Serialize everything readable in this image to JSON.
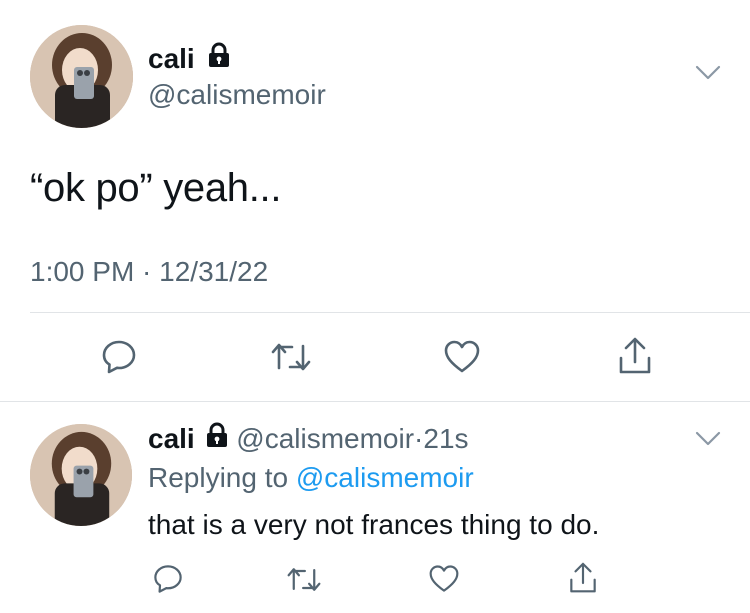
{
  "main_tweet": {
    "display_name": "cali",
    "handle": "@calismemoir",
    "text": "“ok po” yeah...",
    "timestamp": "1:00 PM · 12/31/22",
    "lock_icon": "lock-icon",
    "actions": [
      "reply-icon",
      "retweet-icon",
      "like-icon",
      "share-icon"
    ]
  },
  "reply_tweet": {
    "display_name": "cali",
    "handle": "@calismemoir",
    "separator": "·",
    "time": "21s",
    "replying_prefix": "Replying to",
    "replying_handle": "@calismemoir",
    "text": "that is a very not frances thing to do.",
    "actions": [
      "reply-icon",
      "retweet-icon",
      "like-icon",
      "share-icon"
    ]
  },
  "colors": {
    "text": "#0f1419",
    "secondary": "#536471",
    "link": "#1d9bf0",
    "divider": "#e1e4e7",
    "icon": "#536471"
  }
}
